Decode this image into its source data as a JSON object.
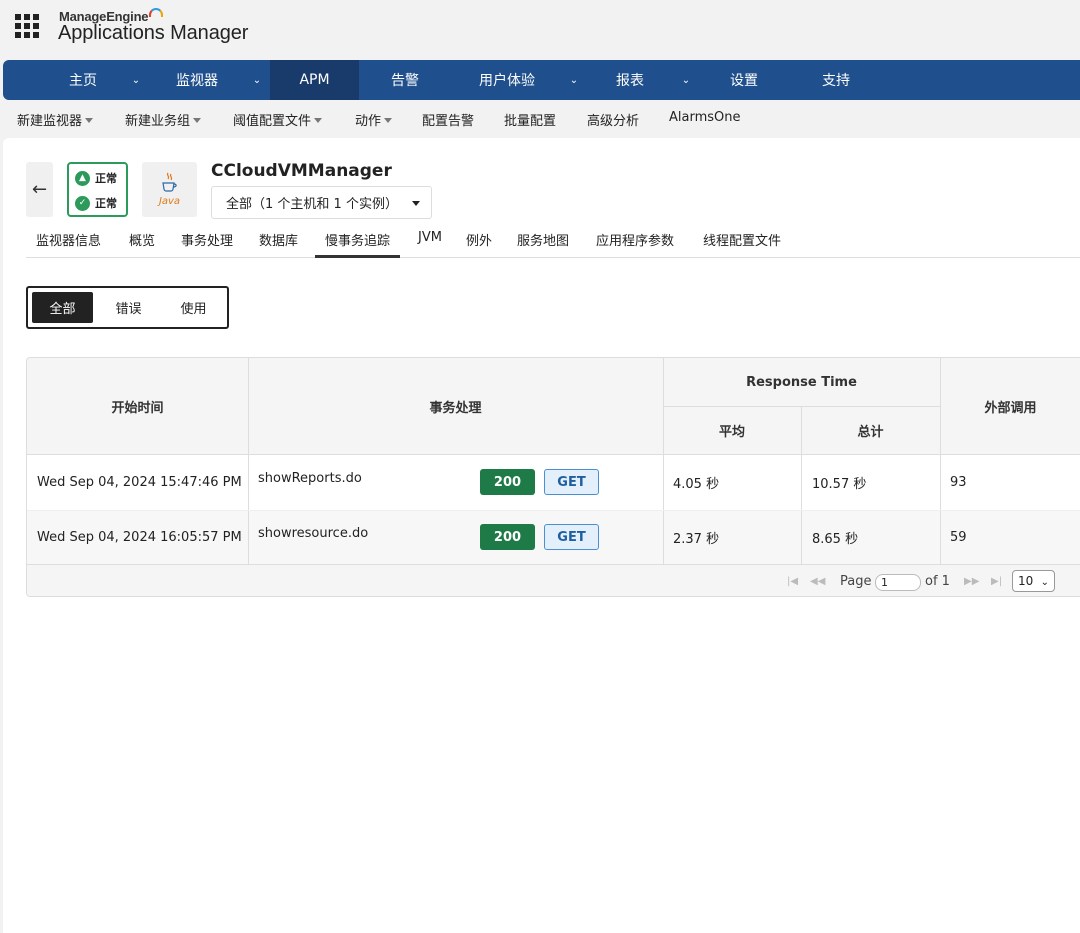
{
  "header": {
    "brand_top": "ManageEngine",
    "brand_main": "Applications Manager"
  },
  "mainnav": {
    "items": [
      {
        "label": "主页"
      },
      {
        "label": "监视器"
      },
      {
        "label": "APM"
      },
      {
        "label": "告警"
      },
      {
        "label": "用户体验"
      },
      {
        "label": "报表"
      },
      {
        "label": "设置"
      },
      {
        "label": "支持"
      }
    ],
    "caret": "⌄"
  },
  "subnav": {
    "items": [
      "新建监视器",
      "新建业务组",
      "阈值配置文件",
      "动作",
      "配置告警",
      "批量配置",
      "高级分析",
      "AlarmsOne"
    ]
  },
  "monitor": {
    "back": "←",
    "status_up": "正常",
    "status_ok": "正常",
    "java_label": "Java",
    "title": "CCloudVMManager",
    "scope": "全部（1 个主机和 1 个实例）"
  },
  "tabs": [
    "监视器信息",
    "概览",
    "事务处理",
    "数据库",
    "慢事务追踪",
    "JVM",
    "例外",
    "服务地图",
    "应用程序参数",
    "线程配置文件"
  ],
  "filter": [
    "全部",
    "错误",
    "使用"
  ],
  "table": {
    "headers": {
      "start_time": "开始时间",
      "transaction": "事务处理",
      "response_time": "Response Time",
      "avg": "平均",
      "total": "总计",
      "external": "外部调用"
    },
    "rows": [
      {
        "start": "Wed Sep 04, 2024 15:47:46 PM",
        "name": "showReports.do",
        "status": "200",
        "method": "GET",
        "avg": "4.05 秒",
        "total": "10.57 秒",
        "external": "93"
      },
      {
        "start": "Wed Sep 04, 2024 16:05:57 PM",
        "name": "showresource.do",
        "status": "200",
        "method": "GET",
        "avg": "2.37 秒",
        "total": "8.65 秒",
        "external": "59"
      }
    ]
  },
  "pager": {
    "page_label": "Page",
    "page_value": "1",
    "of_label": "of 1",
    "page_size": "10"
  }
}
